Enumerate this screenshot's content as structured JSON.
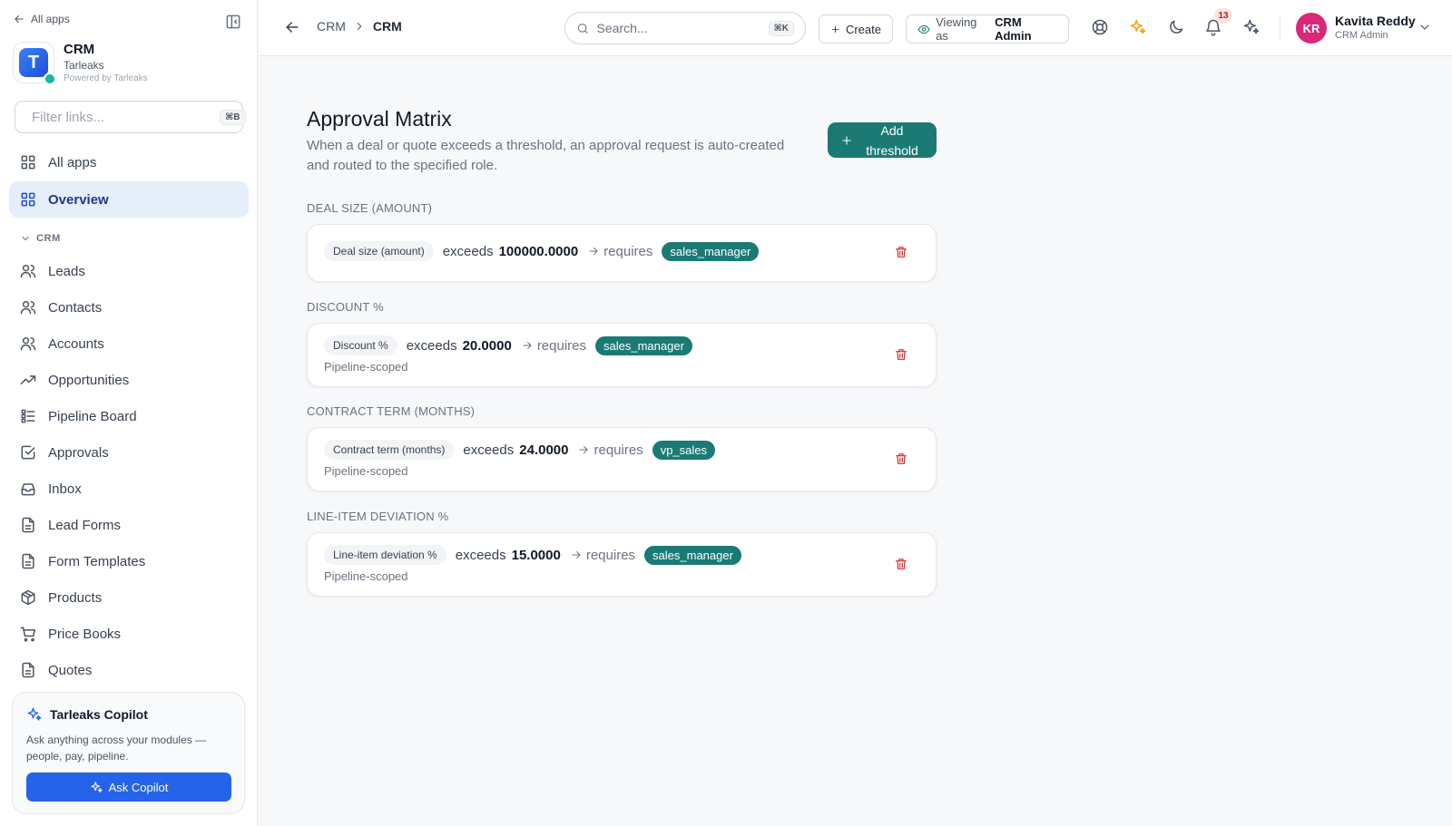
{
  "sidebar": {
    "back_label": "All apps",
    "app_name": "CRM",
    "org_name": "Tarleaks",
    "powered_by": "Powered by Tarleaks",
    "logo_letter": "T",
    "filter_placeholder": "Filter links...",
    "filter_shortcut": "⌘B",
    "top_items": [
      {
        "label": "All apps",
        "icon": "grid-icon"
      },
      {
        "label": "Overview",
        "icon": "grid-icon",
        "active": true
      }
    ],
    "section_label": "CRM",
    "items": [
      {
        "label": "Leads",
        "icon": "users-icon"
      },
      {
        "label": "Contacts",
        "icon": "users-icon"
      },
      {
        "label": "Accounts",
        "icon": "users-icon"
      },
      {
        "label": "Opportunities",
        "icon": "trending-up-icon"
      },
      {
        "label": "Pipeline Board",
        "icon": "list-icon"
      },
      {
        "label": "Approvals",
        "icon": "check-square-icon"
      },
      {
        "label": "Inbox",
        "icon": "inbox-icon"
      },
      {
        "label": "Lead Forms",
        "icon": "file-icon"
      },
      {
        "label": "Form Templates",
        "icon": "file-icon"
      },
      {
        "label": "Products",
        "icon": "package-icon"
      },
      {
        "label": "Price Books",
        "icon": "cart-icon"
      },
      {
        "label": "Quotes",
        "icon": "file-icon"
      }
    ],
    "copilot": {
      "title": "Tarleaks Copilot",
      "description": "Ask anything across your modules — people, pay, pipeline.",
      "button_label": "Ask Copilot"
    }
  },
  "topbar": {
    "breadcrumb": [
      "CRM",
      "CRM"
    ],
    "search_placeholder": "Search...",
    "search_shortcut": "⌘K",
    "create_label": "Create",
    "viewing_prefix": "Viewing as",
    "viewing_role": "CRM Admin",
    "notification_count": "13",
    "user": {
      "initials": "KR",
      "name": "Kavita Reddy",
      "role": "CRM Admin"
    }
  },
  "main": {
    "title": "Approval Matrix",
    "description": "When a deal or quote exceeds a threshold, an approval request is auto-created and routed to the specified role.",
    "add_button_label": "Add threshold",
    "exceeds_word": "exceeds",
    "requires_word": "requires",
    "groups": [
      {
        "heading": "DEAL SIZE (AMOUNT)",
        "metric": "Deal size (amount)",
        "value": "100000.0000",
        "role": "sales_manager",
        "scope": ""
      },
      {
        "heading": "DISCOUNT %",
        "metric": "Discount %",
        "value": "20.0000",
        "role": "sales_manager",
        "scope": "Pipeline-scoped"
      },
      {
        "heading": "CONTRACT TERM (MONTHS)",
        "metric": "Contract term (months)",
        "value": "24.0000",
        "role": "vp_sales",
        "scope": "Pipeline-scoped"
      },
      {
        "heading": "LINE-ITEM DEVIATION %",
        "metric": "Line-item deviation %",
        "value": "15.0000",
        "role": "sales_manager",
        "scope": "Pipeline-scoped"
      }
    ]
  },
  "colors": {
    "primary": "#2563eb",
    "teal": "#1b7a74",
    "danger": "#dc2626",
    "avatar": "#db2777"
  }
}
